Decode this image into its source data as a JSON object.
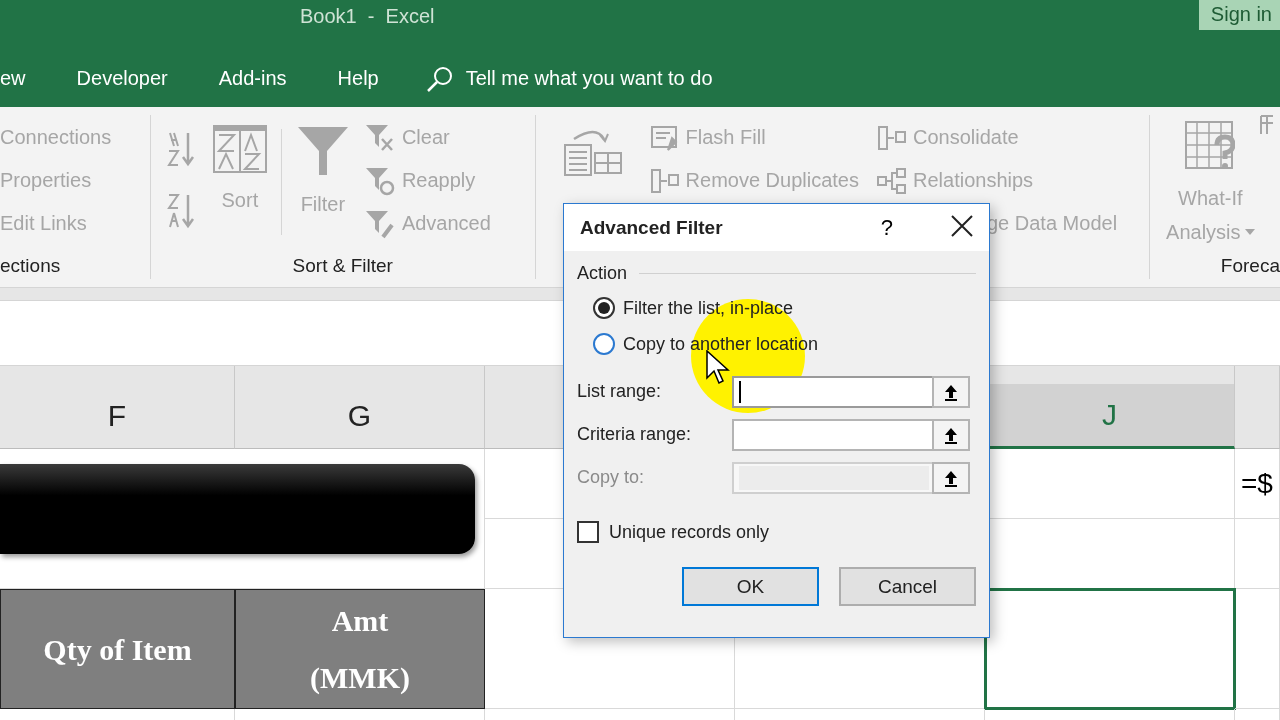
{
  "window": {
    "title": "Book1  -  Excel",
    "sign_in": "Sign in"
  },
  "tabs": [
    {
      "label": "ew"
    },
    {
      "label": "Developer"
    },
    {
      "label": "Add-ins"
    },
    {
      "label": "Help"
    }
  ],
  "tell_me": "Tell me what you want to do",
  "ribbon": {
    "groups": [
      {
        "kind": "connections",
        "label": "ections",
        "items": [
          {
            "label": "Connections"
          },
          {
            "label": "Properties"
          },
          {
            "label": "Edit Links"
          }
        ]
      },
      {
        "kind": "sort_filter",
        "label": "Sort & Filter",
        "sort": "Sort",
        "filter": "Filter",
        "items": [
          {
            "label": "Clear"
          },
          {
            "label": "Reapply"
          },
          {
            "label": "Advanced"
          }
        ]
      },
      {
        "kind": "data_tools",
        "items": [
          {
            "label": "Flash Fill"
          },
          {
            "label": "Remove Duplicates"
          },
          {
            "label": "Consolidate"
          },
          {
            "label": "Relationships"
          },
          {
            "label": "ge Data Model"
          }
        ]
      },
      {
        "kind": "forecast",
        "label": "Foreca",
        "button": "What-If",
        "button_line2": "Analysis"
      }
    ]
  },
  "sheet": {
    "columns": [
      {
        "label": "F",
        "selected": false
      },
      {
        "label": "G",
        "selected": false
      },
      {
        "label": "J",
        "selected": true
      }
    ],
    "header_cells": [
      {
        "text": "Qty of Item"
      },
      {
        "text": "Amt\n(MMK)"
      }
    ],
    "formula_text": "=$"
  },
  "dialog": {
    "title": "Advanced Filter",
    "help": "?",
    "section": "Action",
    "options": [
      {
        "label": "Filter the list, in-place",
        "selected": true
      },
      {
        "label": "Copy to another location",
        "selected": false
      }
    ],
    "fields": [
      {
        "label": "List range:",
        "focused": true,
        "disabled": false
      },
      {
        "label": "Criteria range:",
        "focused": false,
        "disabled": false
      },
      {
        "label": "Copy to:",
        "focused": false,
        "disabled": true
      }
    ],
    "checkbox": {
      "label": "Unique records only",
      "checked": false
    },
    "buttons": [
      {
        "label": "OK",
        "default": true
      },
      {
        "label": "Cancel",
        "default": false
      }
    ]
  }
}
